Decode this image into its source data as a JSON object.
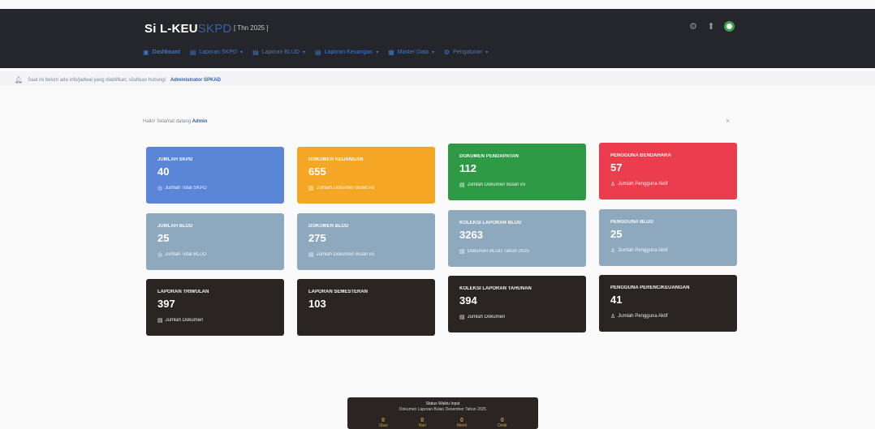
{
  "app": {
    "brand_main": "Si L-KEU",
    "brand_accent": "SKPD",
    "year_tag": "[ Thn 2025 ]"
  },
  "header_icons": [
    "gear-icon",
    "bell-icon",
    "user-avatar"
  ],
  "nav": [
    {
      "label": "Dashboard",
      "icon": "▣",
      "active": true
    },
    {
      "label": "Laporan SKPD",
      "icon": "▤",
      "chevron": "▾"
    },
    {
      "label": "Laporan BLUD",
      "icon": "▤",
      "chevron": "▾"
    },
    {
      "label": "Laporan Keuangan",
      "icon": "▤",
      "chevron": "▾"
    },
    {
      "label": "Master Data",
      "icon": "▦",
      "chevron": "▾"
    },
    {
      "label": "Pengaturan",
      "icon": "⚙",
      "chevron": "▾"
    }
  ],
  "notice": {
    "text": "Saat ini belum ada info/jadwal yang diaktifkan, silahkan hubungi",
    "bold": "Administrator SPKAD"
  },
  "greeting": {
    "prefix": "Hallo! Selamat datang",
    "name": "Admin"
  },
  "cards": [
    {
      "title": "JUMLAH SKPD",
      "value": "40",
      "sub": "Jumlah Total SKPD",
      "icon": "◎",
      "color": "#5b86d8"
    },
    {
      "title": "DOKUMEN KEUANGAN",
      "value": "655",
      "sub": "Jumlah Dokumen Bulan ini",
      "icon": "▤",
      "color": "#f4a724"
    },
    {
      "title": "DOKUMEN PENDAPATAN",
      "value": "112",
      "sub": "Jumlah Dokumen Bulan ini",
      "icon": "▤",
      "color": "#2f9a45"
    },
    {
      "title": "PENGGUNA BENDAHARA",
      "value": "57",
      "sub": "Jumlah Pengguna Aktif",
      "icon": "♙",
      "color": "#ea3d4e"
    },
    {
      "title": "JUMLAH BLUD",
      "value": "25",
      "sub": "Jumlah Total BLUD",
      "icon": "◎",
      "color": "#8ea8be"
    },
    {
      "title": "DOKUMEN BLUD",
      "value": "275",
      "sub": "Jumlah Dokumen Bulan ini",
      "icon": "▤",
      "color": "#8ea8be"
    },
    {
      "title": "KOLEKSI LAPORAN BLUD",
      "value": "3263",
      "sub": "Dokumen BLUD Tahun 2025",
      "icon": "▤",
      "color": "#8ea8be"
    },
    {
      "title": "PENGGUNA BLUD",
      "value": "25",
      "sub": "Jumlah Pengguna Aktif",
      "icon": "♙",
      "color": "#8ea8be"
    },
    {
      "title": "LAPORAN TRIWULAN",
      "value": "397",
      "sub": "Jumlah Dokumen",
      "icon": "▤",
      "color": "#2a2523"
    },
    {
      "title": "LAPORAN SEMESTERAN",
      "value": "103",
      "sub": "",
      "icon": "",
      "color": "#2a2523"
    },
    {
      "title": "KOLEKSI LAPORAN TAHUNAN",
      "value": "394",
      "sub": "Jumlah Dokumen",
      "icon": "▤",
      "color": "#2a2523"
    },
    {
      "title": "PENGGUNA PERENC/KEUANGAN",
      "value": "41",
      "sub": "Jumlah Pengguna Aktif",
      "icon": "♙",
      "color": "#2a2523"
    }
  ],
  "popup": {
    "line1": "Status Waktu Input",
    "line2": "Dokumen Laporan Bulan Desember Tahun 2025",
    "stats": [
      {
        "value": "0",
        "label": "Ulasi"
      },
      {
        "value": "0",
        "label": "Hari"
      },
      {
        "value": "0",
        "label": "Menit"
      },
      {
        "value": "0",
        "label": "Detik"
      }
    ]
  }
}
